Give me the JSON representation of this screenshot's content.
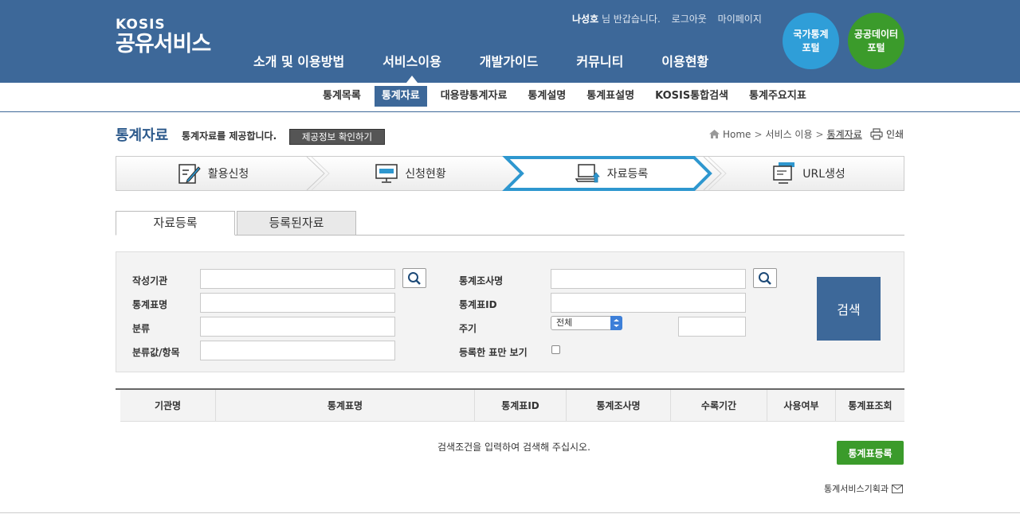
{
  "logo": {
    "line1": "KOSIS",
    "line2": "공유서비스"
  },
  "util": {
    "user": "나성호",
    "greet": "님 반갑습니다.",
    "logout": "로그아웃",
    "mypage": "마이페이지"
  },
  "gnb": [
    "소개 및 이용방법",
    "서비스이용",
    "개발가이드",
    "커뮤니티",
    "이용현황"
  ],
  "portals": {
    "p1": "국가통계\n포털",
    "p2": "공공데이터\n포털",
    "p1a": "국가통계",
    "p1b": "포털",
    "p2a": "공공데이터",
    "p2b": "포털"
  },
  "subnav": [
    "통계목록",
    "통계자료",
    "대용량통계자료",
    "통계설명",
    "통계표설명",
    "KOSIS통합검색",
    "통계주요지표"
  ],
  "page": {
    "title": "통계자료",
    "desc": "통계자료를 제공합니다.",
    "info_btn": "제공정보 확인하기"
  },
  "breadcrumb": {
    "home": "Home",
    "c1": "서비스 이용",
    "c2": "통계자료"
  },
  "print": "인쇄",
  "steps": [
    "활용신청",
    "신청현황",
    "자료등록",
    "URL생성"
  ],
  "tabs": [
    "자료등록",
    "등록된자료"
  ],
  "form": {
    "org": "작성기관",
    "survey": "통계조사명",
    "table_name": "통계표명",
    "table_id": "통계표ID",
    "category": "분류",
    "cycle": "주기",
    "cycle_value": "전체",
    "cat_item": "분류값/항목",
    "only_registered": "등록한 표만 보기",
    "search_btn": "검색"
  },
  "table": {
    "columns": [
      "기관명",
      "통계표명",
      "통계표ID",
      "통계조사명",
      "수록기간",
      "사용여부",
      "통계표조회"
    ],
    "empty": "검색조건을 입력하여 검색해 주십시오."
  },
  "register_btn": "통계표등록",
  "contact": "통계서비스기획과",
  "colors": {
    "header": "#3d6899",
    "green": "#3b9b2b",
    "blue_portal": "#2f9ed8"
  }
}
